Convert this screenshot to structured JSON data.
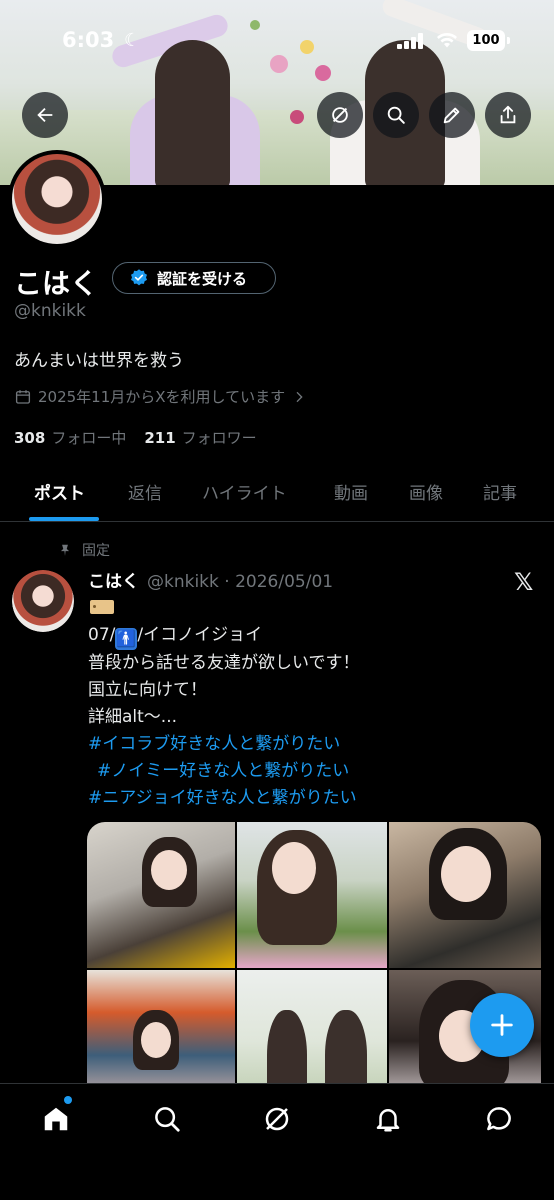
{
  "status_bar": {
    "time": "6:03",
    "battery": "100"
  },
  "header": {
    "back_icon": "back-arrow-icon",
    "grok_icon": "grok-icon",
    "search_icon": "search-icon",
    "edit_icon": "pencil-icon",
    "share_icon": "share-icon"
  },
  "profile": {
    "name": "こはく",
    "verify_button": "認証を受ける",
    "handle": "@knkikk",
    "bio": "あんまいは世界を救う",
    "joined": "2025年11月からXを利用しています",
    "following_count": "308",
    "following_label": "フォロー中",
    "followers_count": "211",
    "followers_label": "フォロワー"
  },
  "tabs": [
    {
      "label": "ポスト",
      "active": true
    },
    {
      "label": "返信",
      "active": false
    },
    {
      "label": "ハイライト",
      "active": false
    },
    {
      "label": "動画",
      "active": false
    },
    {
      "label": "画像",
      "active": false
    },
    {
      "label": "記事",
      "active": false
    }
  ],
  "post": {
    "pinned_label": "固定",
    "author_name": "こはく",
    "author_handle": "@knkikk",
    "separator": "·",
    "date": "2026/05/01",
    "lines": {
      "l1_prefix": "07/",
      "l1_suffix": "/イコノイジョイ",
      "l2": "普段から話せる友達が欲しいです！",
      "l3": "国立に向けて！",
      "l4": "詳細alt〜...",
      "h1": "#イコラブ好きな人と繋がりたい",
      "h2": "#ノイミー好きな人と繋がりたい",
      "h3": "#ニアジョイ好きな人と繋がりたい"
    },
    "media_count": 6
  },
  "colors": {
    "accent": "#1d9bf0",
    "background": "#000000",
    "muted": "#71767b"
  },
  "bottom_nav": [
    "home-icon",
    "search-icon",
    "grok-icon",
    "notifications-icon",
    "messages-icon"
  ]
}
